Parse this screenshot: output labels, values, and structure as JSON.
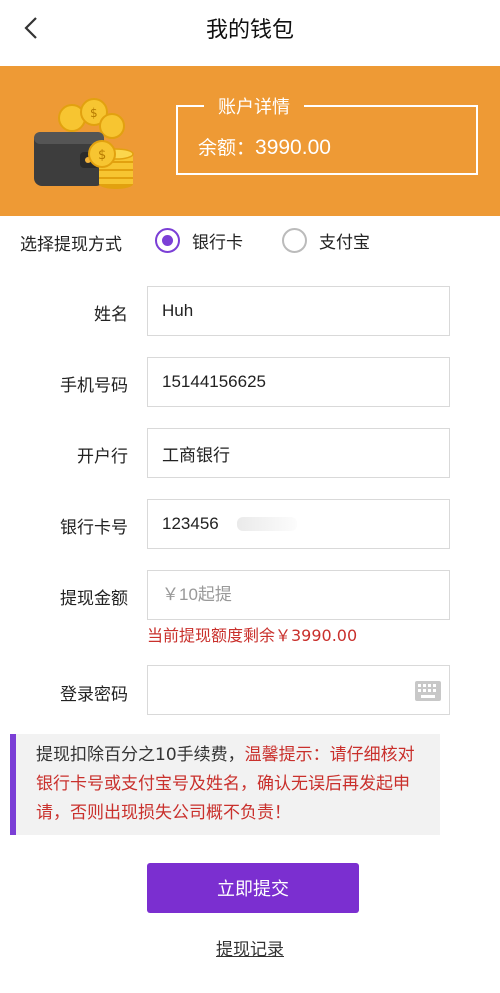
{
  "header": {
    "title": "我的钱包"
  },
  "account": {
    "section_title": "账户详情",
    "balance_label": "余额：",
    "balance_value": "3990.00"
  },
  "withdraw_method": {
    "label": "选择提现方式",
    "options": [
      {
        "label": "银行卡",
        "selected": true
      },
      {
        "label": "支付宝",
        "selected": false
      }
    ]
  },
  "form": {
    "name": {
      "label": "姓名",
      "value": "Huh"
    },
    "phone": {
      "label": "手机号码",
      "value": "15144156625"
    },
    "bank": {
      "label": "开户行",
      "value": "工商银行"
    },
    "card_number": {
      "label": "银行卡号",
      "value": "123456"
    },
    "amount": {
      "label": "提现金额",
      "placeholder": "￥10起提",
      "quota_text": "当前提现额度剩余￥3990.00"
    },
    "password": {
      "label": "登录密码",
      "value": ""
    }
  },
  "notice": {
    "text": "提现扣除百分之10手续费，",
    "warning": "温馨提示：请仔细核对银行卡号或支付宝号及姓名，确认无误后再发起申请，否则出现损失公司概不负责！"
  },
  "actions": {
    "submit_label": "立即提交",
    "history_label": "提现记录"
  },
  "colors": {
    "banner": "#ee9a35",
    "accent": "#7b2fd0",
    "warning": "#c9302c"
  },
  "icons": [
    "back-arrow-icon",
    "wallet-coins-icon",
    "keyboard-icon"
  ]
}
